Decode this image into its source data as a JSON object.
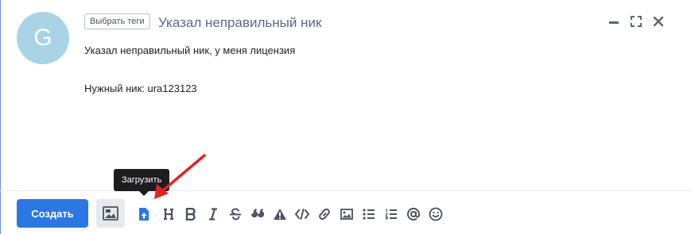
{
  "ticket": {
    "avatar_letter": "G",
    "tag_button_label": "Выбрать теги",
    "subject": "Указал неправильный ник",
    "body_line1": "Указал неправильный ник, у меня лицензия",
    "body_line2": "Нужный ник: ura123123"
  },
  "window_controls": {
    "icons": [
      "minimize-icon",
      "fullscreen-icon",
      "close-icon"
    ]
  },
  "toolbar": {
    "create_label": "Создать",
    "media_icon": "image-gallery-icon",
    "tooltip": "Загрузить",
    "formatting_icons": [
      "upload-icon",
      "heading-icon",
      "bold-icon",
      "italic-icon",
      "strikethrough-icon",
      "quote-icon",
      "warning-icon",
      "code-icon",
      "link-icon",
      "image-icon",
      "bullet-list-icon",
      "numbered-list-icon",
      "mention-icon",
      "emoji-icon"
    ]
  },
  "colors": {
    "accent": "#2b78e4",
    "avatar_bg": "#a8d4e5",
    "subject_text": "#5b6a86",
    "annotation_arrow": "#e02424",
    "tooltip_bg": "#1d1d1f"
  }
}
